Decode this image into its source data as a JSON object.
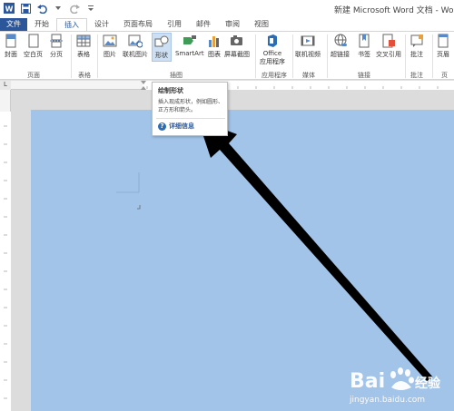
{
  "window": {
    "title": "新建 Microsoft Word 文档 - Word"
  },
  "tabs": [
    {
      "label": "文件"
    },
    {
      "label": "开始"
    },
    {
      "label": "插入"
    },
    {
      "label": "设计"
    },
    {
      "label": "页面布局"
    },
    {
      "label": "引用"
    },
    {
      "label": "邮件"
    },
    {
      "label": "审阅"
    },
    {
      "label": "视图"
    }
  ],
  "ribbon": {
    "buttons": {
      "cover": "封面",
      "blank": "空白页",
      "break": "分页",
      "table": "表格",
      "picture": "图片",
      "online_picture": "联机图片",
      "shapes": "形状",
      "smartart": "SmartArt",
      "chart": "图表",
      "screenshot": "屏幕截图",
      "office_line1": "Office",
      "office_line2": "应用程序",
      "online_video": "联机视频",
      "hyperlink": "超链接",
      "bookmark": "书签",
      "crossref": "交叉引用",
      "comment": "批注",
      "header": "页眉"
    },
    "groups": {
      "pages": "页面",
      "tables": "表格",
      "illustrations": "插图",
      "apps": "应用程序",
      "media": "媒体",
      "links": "链接",
      "comments": "批注",
      "header_footer": "页"
    }
  },
  "ruler": {
    "corner": "L"
  },
  "tooltip": {
    "title": "绘制形状",
    "description": "插入现成形状，例如圆形、正方形和箭头。",
    "help": "详细信息"
  },
  "watermark": {
    "brand": "Bai",
    "brand2": "经验",
    "url": "jingyan.baidu.com"
  },
  "colors": {
    "accent": "#2b579a",
    "page": "#a2c4e9",
    "arrow": "#000000"
  }
}
